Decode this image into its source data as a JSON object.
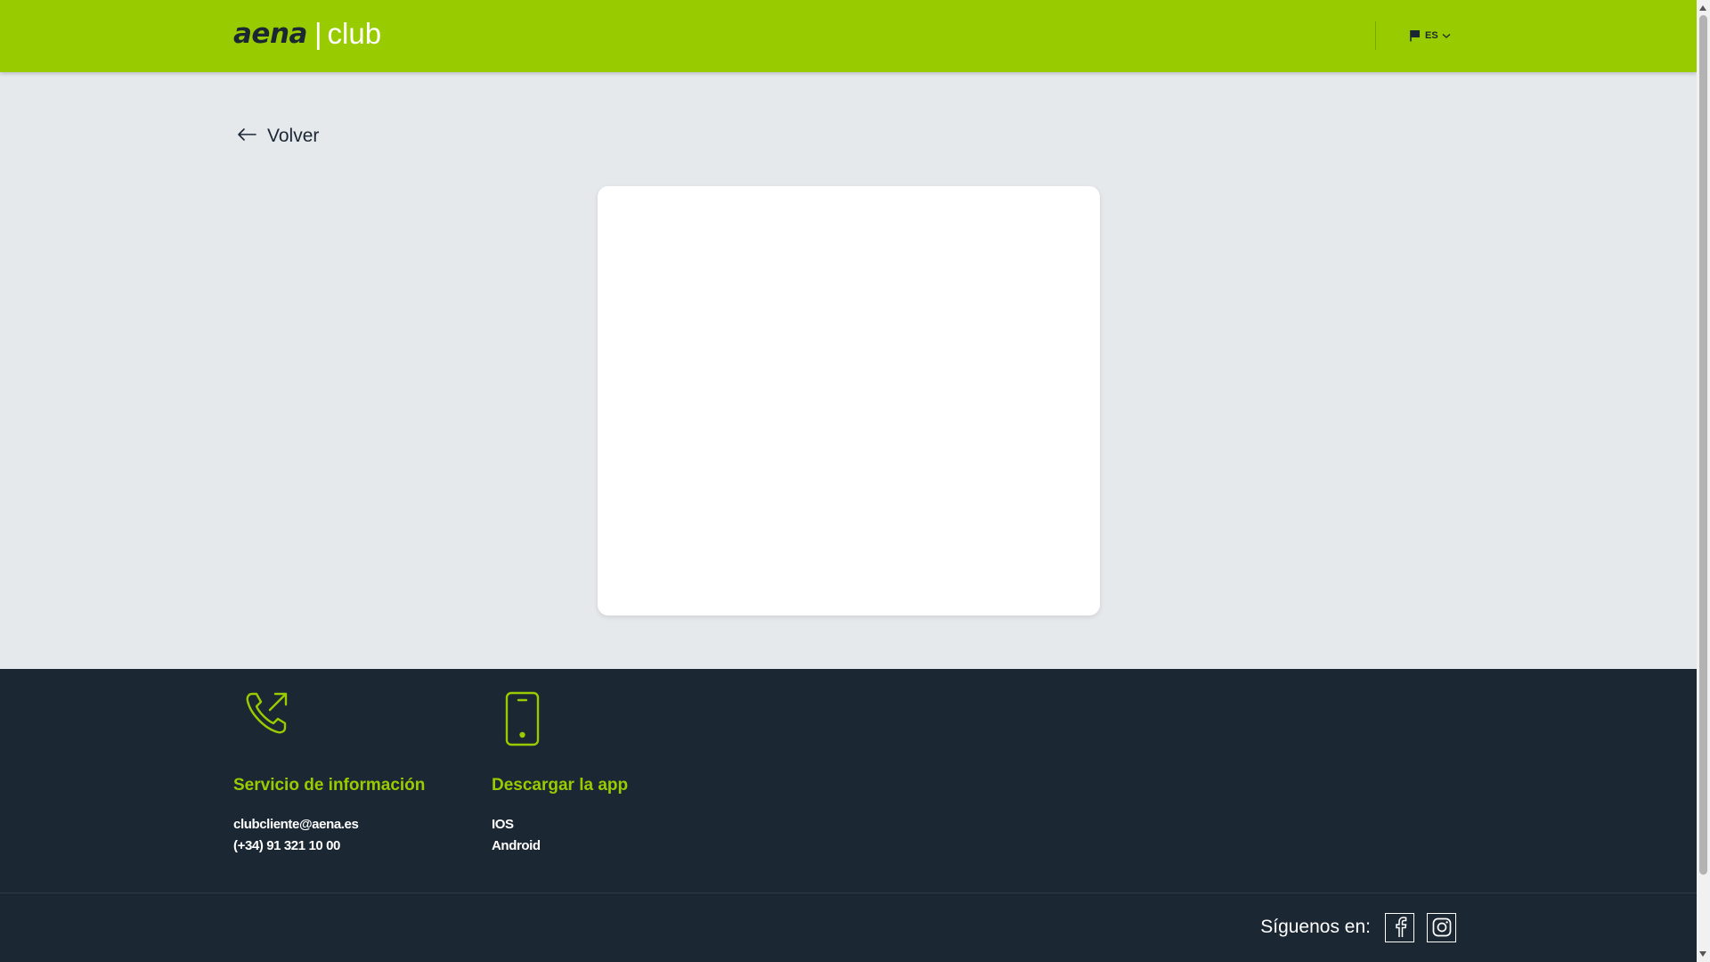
{
  "header": {
    "logo": {
      "brand": "aena",
      "separator": "|",
      "product": "club"
    },
    "language": {
      "label": "ES",
      "icon": "flag-icon",
      "chevron": "chevron-down-icon"
    }
  },
  "back": {
    "label": "Volver",
    "icon": "arrow-left-icon"
  },
  "footer": {
    "info": {
      "icon": "phone-outgoing-icon",
      "title": "Servicio de información",
      "email": "clubcliente@aena.es",
      "phone": "(+34) 91 321 10 00"
    },
    "app": {
      "icon": "smartphone-icon",
      "title": "Descargar la app",
      "ios": "IOS",
      "android": "Android"
    },
    "social": {
      "label": "Síguenos en:",
      "networks": [
        "facebook-icon",
        "instagram-icon"
      ]
    }
  },
  "colors": {
    "brand_green": "#99cc00",
    "dark_navy": "#1b2733",
    "page_bg": "#e6e9ec",
    "card_bg": "#ffffff"
  }
}
